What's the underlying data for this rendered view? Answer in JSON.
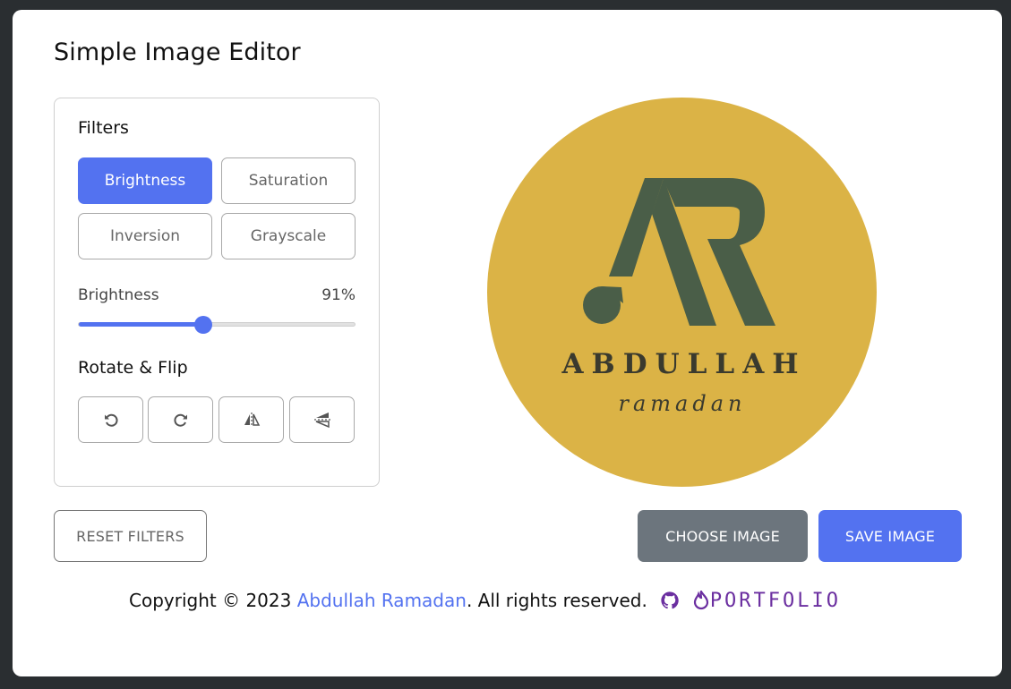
{
  "app": {
    "title": "Simple Image Editor"
  },
  "filters": {
    "heading": "Filters",
    "buttons": [
      {
        "label": "Brightness",
        "active": true
      },
      {
        "label": "Saturation",
        "active": false
      },
      {
        "label": "Inversion",
        "active": false
      },
      {
        "label": "Grayscale",
        "active": false
      }
    ],
    "slider": {
      "name": "Brightness",
      "value_text": "91%",
      "fraction": 0.45
    }
  },
  "rotate": {
    "heading": "Rotate & Flip",
    "buttons": [
      {
        "icon": "rotate-left-icon"
      },
      {
        "icon": "rotate-right-icon"
      },
      {
        "icon": "flip-horizontal-icon"
      },
      {
        "icon": "flip-vertical-icon"
      }
    ]
  },
  "preview": {
    "logo_main": "ABDULLAH",
    "logo_sub": "ramadan",
    "logo_letters": "AR"
  },
  "actions": {
    "reset": "RESET FILTERS",
    "choose": "CHOOSE IMAGE",
    "save": "SAVE IMAGE"
  },
  "footer": {
    "prefix": "Copyright © 2023",
    "author": "Abdullah Ramadan",
    "suffix": ". All rights reserved.",
    "github_icon": "github-icon",
    "portfolio_label": "PORTFOLIO"
  },
  "colors": {
    "accent": "#5372f0",
    "secondary": "#6c757d",
    "logo_bg": "#dbb346",
    "logo_fg": "#4a5e48"
  }
}
